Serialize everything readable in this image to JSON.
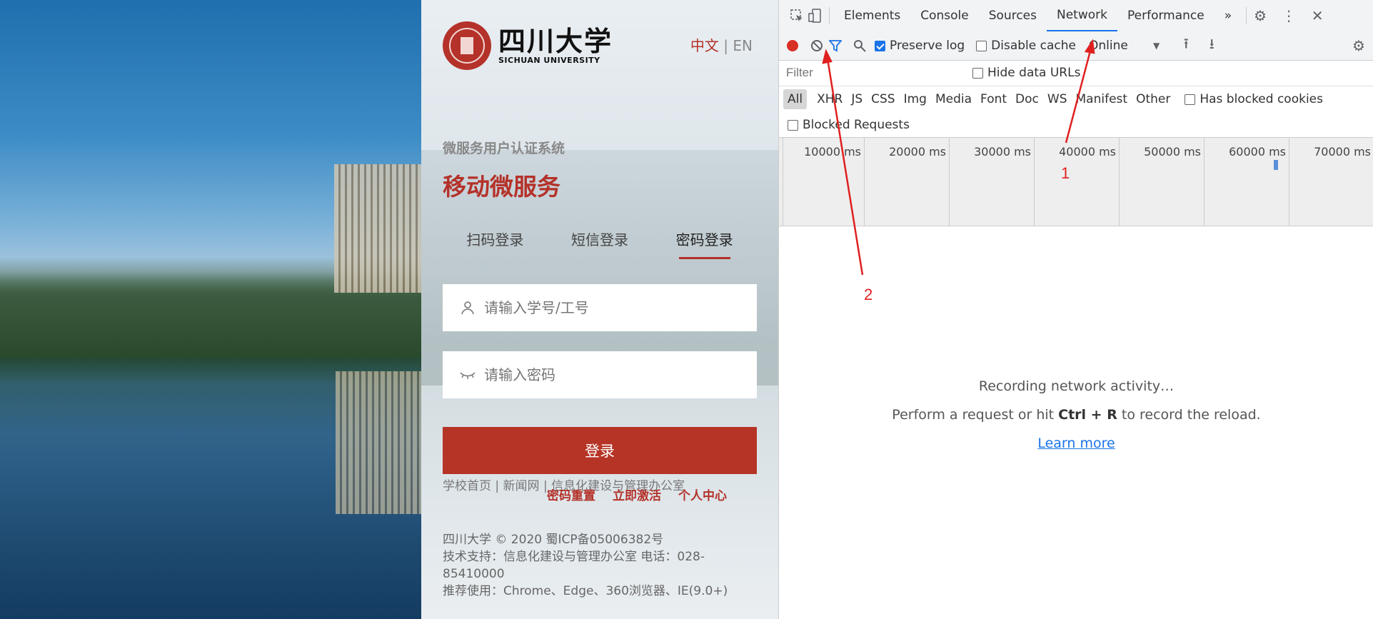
{
  "login": {
    "logo_cn": "四川大学",
    "logo_en": "SICHUAN UNIVERSITY",
    "lang_active": "中文",
    "lang_sep": "|",
    "lang_other": "EN",
    "subtitle": "微服务用户认证系统",
    "title": "移动微服务",
    "tabs": [
      "扫码登录",
      "短信登录",
      "密码登录"
    ],
    "active_tab": "密码登录",
    "username_placeholder": "请输入学号/工号",
    "password_placeholder": "请输入密码",
    "login_button": "登录",
    "links_line": "学校首页 | 新闻网 | 信息化建设与管理办公室",
    "links_red": [
      "密码重置",
      "立即激活",
      "个人中心"
    ],
    "footer": [
      "四川大学 © 2020 蜀ICP备05006382号",
      "技术支持：信息化建设与管理办公室 电话：028-85410000",
      "推荐使用：Chrome、Edge、360浏览器、IE(9.0+)"
    ],
    "brand_color": "#b4322a"
  },
  "devtools": {
    "tabs": [
      "Elements",
      "Console",
      "Sources",
      "Network",
      "Performance"
    ],
    "selected_tab": "Network",
    "more_tabs": "»",
    "preserve_log": "Preserve log",
    "disable_cache": "Disable cache",
    "throttle": "Online",
    "filter_placeholder": "Filter",
    "hide_data_urls": "Hide data URLs",
    "filter_types": [
      "All",
      "XHR",
      "JS",
      "CSS",
      "Img",
      "Media",
      "Font",
      "Doc",
      "WS",
      "Manifest",
      "Other"
    ],
    "has_blocked_cookies": "Has blocked cookies",
    "blocked_requests": "Blocked Requests",
    "timeline_ticks": [
      "10000 ms",
      "20000 ms",
      "30000 ms",
      "40000 ms",
      "50000 ms",
      "60000 ms",
      "70000 ms"
    ],
    "empty_title": "Recording network activity…",
    "empty_line_pre": "Perform a request or hit ",
    "empty_line_key": "Ctrl + R",
    "empty_line_post": " to record the reload.",
    "learn_more": "Learn more",
    "accent": "#1a73e8"
  },
  "annotations": {
    "label_1": "1",
    "label_2": "2",
    "color": "#e02020"
  }
}
